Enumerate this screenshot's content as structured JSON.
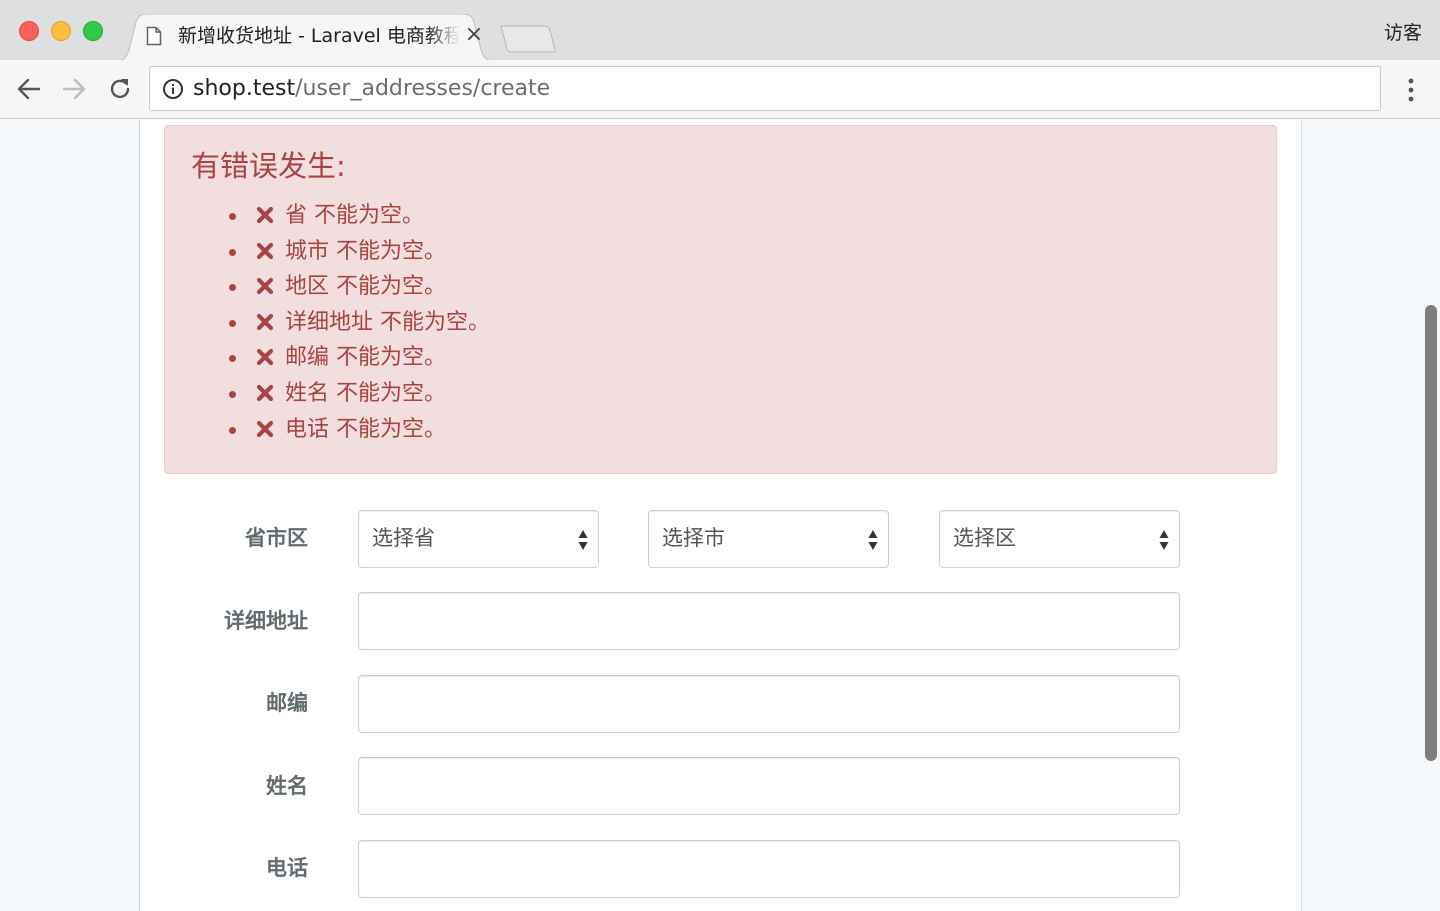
{
  "browser": {
    "tab": {
      "title": "新增收货地址 - Laravel 电商教程",
      "close_glyph": "×",
      "icon": "page-icon"
    },
    "profile_label": "访客",
    "address": {
      "host": "shop.test",
      "path": "/user_addresses/create"
    },
    "icons": {
      "back": "arrow-left-icon",
      "forward": "arrow-right-icon",
      "reload": "reload-icon",
      "site_info": "info-icon",
      "menu": "kebab-menu-icon"
    },
    "colors": {
      "titlebar": "#dddfe1",
      "toolbar": "#f6f6f6"
    }
  },
  "alert": {
    "title": "有错误发生:",
    "icon": "times-icon",
    "errors": [
      "省 不能为空。",
      "城市 不能为空。",
      "地区 不能为空。",
      "详细地址 不能为空。",
      "邮编 不能为空。",
      "姓名 不能为空。",
      "电话 不能为空。"
    ],
    "colors": {
      "background": "#f2dede",
      "border": "#ebccd1",
      "text": "#a94442"
    }
  },
  "form": {
    "region": {
      "label": "省市区",
      "province_placeholder": "选择省",
      "city_placeholder": "选择市",
      "district_placeholder": "选择区"
    },
    "address": {
      "label": "详细地址",
      "value": ""
    },
    "zip": {
      "label": "邮编",
      "value": ""
    },
    "contact_name": {
      "label": "姓名",
      "value": ""
    },
    "contact_phone": {
      "label": "电话",
      "value": ""
    }
  }
}
